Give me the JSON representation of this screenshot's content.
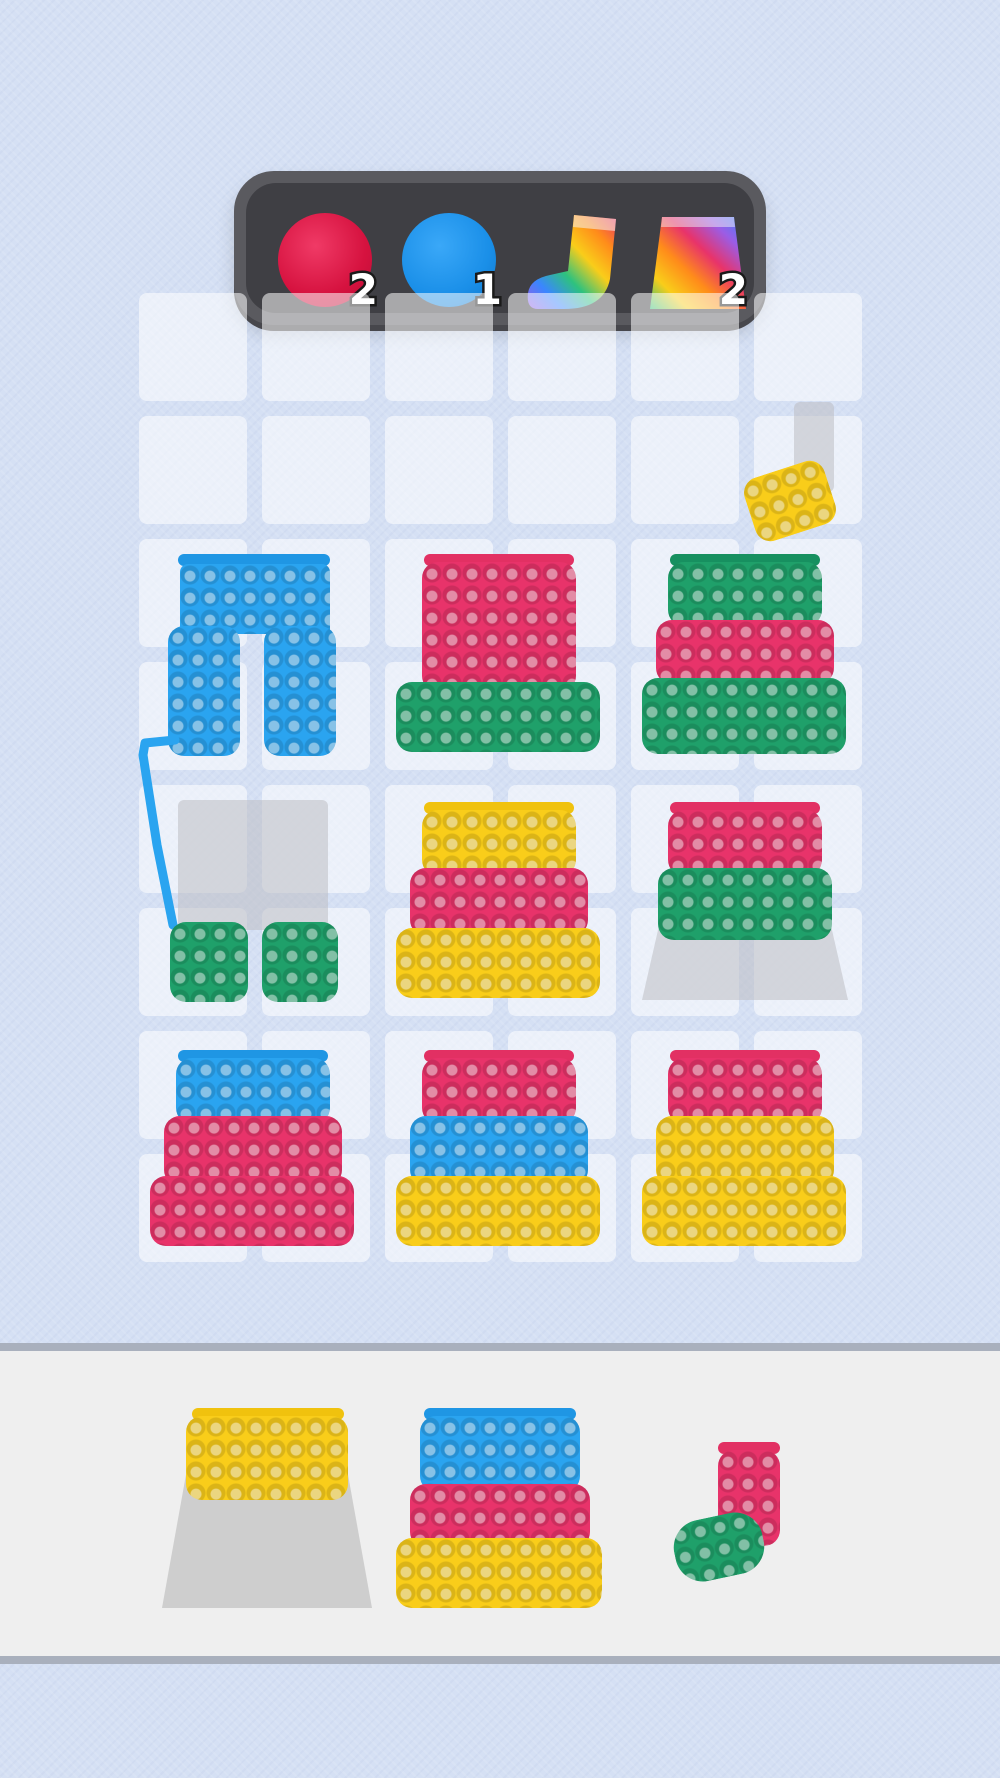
{
  "goals": [
    {
      "kind": "red-ball",
      "color": "#e4184a",
      "count": "2"
    },
    {
      "kind": "blue-ball",
      "color": "#1a8fe8",
      "count": "1"
    },
    {
      "kind": "rainbow-sock",
      "count": ""
    },
    {
      "kind": "rainbow-skirt",
      "count": "2"
    }
  ],
  "colors": {
    "blue": "#2aa4f0",
    "red": "#e8336a",
    "green": "#1fa06a",
    "yellow": "#f9cd1a",
    "background": "#d5e0f4"
  },
  "board": {
    "rows": 8,
    "cols": 6,
    "garments": [
      {
        "name": "blue-pants",
        "type": "pants",
        "stripes": [
          "blue"
        ]
      },
      {
        "name": "skirt-red-green",
        "type": "skirt",
        "stripes": [
          "red",
          "red",
          "green"
        ]
      },
      {
        "name": "skirt-green-red-green",
        "type": "skirt",
        "stripes": [
          "green",
          "red",
          "green"
        ]
      },
      {
        "name": "pants-green-cuffs",
        "type": "pants-partial",
        "stripes": [
          "green"
        ]
      },
      {
        "name": "skirt-yellow-red-yellow",
        "type": "skirt",
        "stripes": [
          "yellow",
          "red",
          "yellow"
        ]
      },
      {
        "name": "skirt-red-green-partial",
        "type": "skirt-partial",
        "stripes": [
          "red",
          "green"
        ]
      },
      {
        "name": "skirt-blue-red",
        "type": "skirt",
        "stripes": [
          "blue",
          "red",
          "red"
        ]
      },
      {
        "name": "skirt-red-blue-yellow",
        "type": "skirt",
        "stripes": [
          "red",
          "blue",
          "yellow"
        ]
      },
      {
        "name": "skirt-red-yellow",
        "type": "skirt",
        "stripes": [
          "red",
          "yellow",
          "yellow"
        ]
      }
    ],
    "yarn_ball": "yellow"
  },
  "tray": {
    "items": [
      {
        "name": "tray-skirt-yellow-partial",
        "stripes": [
          "yellow"
        ]
      },
      {
        "name": "tray-skirt-blue-red-yellow",
        "stripes": [
          "blue",
          "red",
          "yellow"
        ]
      },
      {
        "name": "tray-sock-red-green",
        "stripes": [
          "red",
          "green"
        ]
      }
    ]
  }
}
